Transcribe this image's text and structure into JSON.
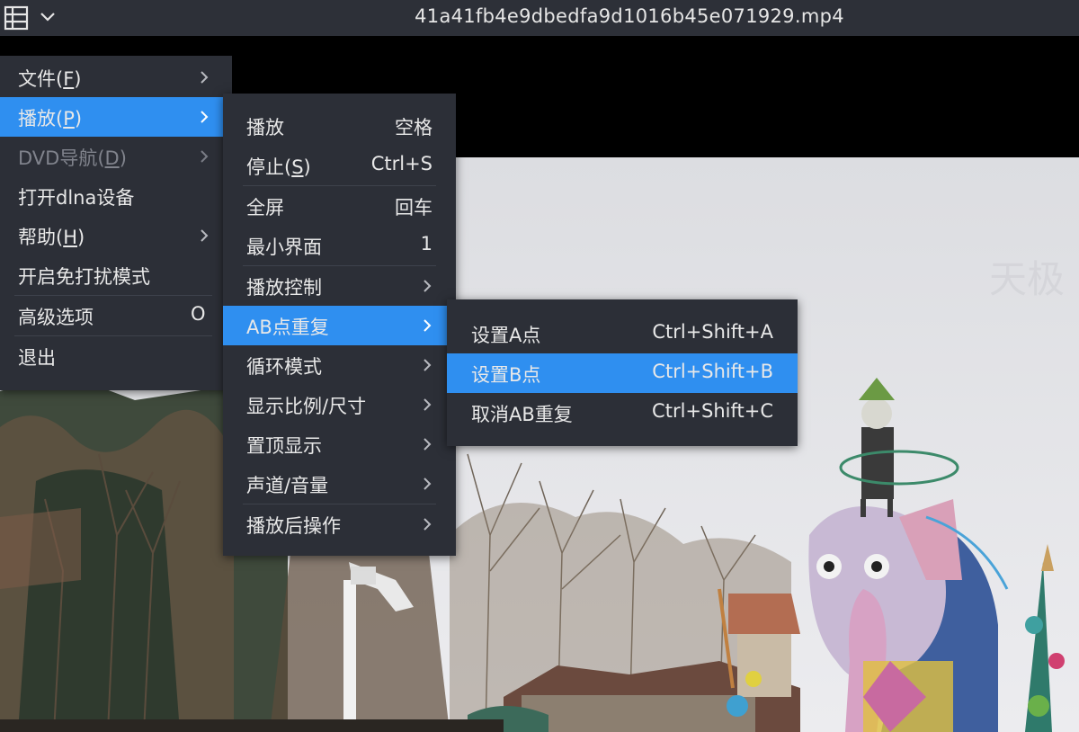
{
  "title_bar": {
    "menu_icon": "list-menu-icon",
    "dropdown_icon": "chevron-down-icon",
    "filename": "41a41fb4e9dbedfa9d1016b45e071929.mp4"
  },
  "colors": {
    "titlebar_bg": "#2d3038",
    "menu_bg": "#2c2f37",
    "highlight": "#2f8ff0",
    "text": "#e8e8e8",
    "disabled_text": "#80838c"
  },
  "main_menu": {
    "items": [
      {
        "label": "文件(",
        "key": "F",
        "suffix": ")",
        "submenu": true
      },
      {
        "label": "播放(",
        "key": "P",
        "suffix": ")",
        "submenu": true,
        "active": true
      },
      {
        "label": "DVD导航(",
        "key": "D",
        "suffix": ")",
        "submenu": true,
        "disabled": true
      },
      {
        "label": "打开dlna设备",
        "submenu": false
      },
      {
        "label": "帮助(",
        "key": "H",
        "suffix": ")",
        "submenu": true
      },
      {
        "label": "开启免打扰模式",
        "submenu": false
      },
      {
        "label": "高级选项",
        "shortcut": "O",
        "submenu": false
      },
      {
        "label": "退出",
        "submenu": false
      }
    ]
  },
  "play_menu": {
    "items": [
      {
        "label": "播放",
        "shortcut": "空格"
      },
      {
        "label": "停止(",
        "key": "S",
        "suffix": ")",
        "shortcut": "Ctrl+S"
      },
      {
        "label": "全屏",
        "shortcut": "回车"
      },
      {
        "label": "最小界面",
        "shortcut": "1"
      },
      {
        "label": "播放控制",
        "submenu": true
      },
      {
        "label": "AB点重复",
        "submenu": true,
        "active": true
      },
      {
        "label": "循环模式",
        "submenu": true
      },
      {
        "label": "显示比例/尺寸",
        "submenu": true
      },
      {
        "label": "置顶显示",
        "submenu": true
      },
      {
        "label": "声道/音量",
        "submenu": true
      },
      {
        "label": "播放后操作",
        "submenu": true
      }
    ]
  },
  "ab_menu": {
    "items": [
      {
        "label": "设置A点",
        "shortcut": "Ctrl+Shift+A"
      },
      {
        "label": "设置B点",
        "shortcut": "Ctrl+Shift+B",
        "active": true
      },
      {
        "label": "取消AB重复",
        "shortcut": "Ctrl+Shift+C"
      }
    ]
  },
  "video": {
    "watermark": "天极"
  }
}
